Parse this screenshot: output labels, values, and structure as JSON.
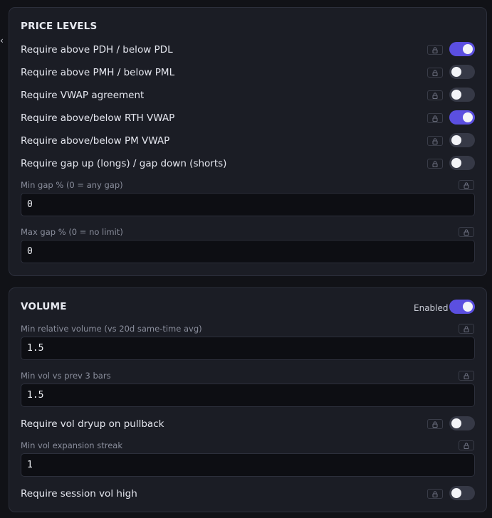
{
  "price_levels": {
    "title": "PRICE LEVELS",
    "toggles": [
      {
        "label": "Require above PDH / below PDL",
        "on": true
      },
      {
        "label": "Require above PMH / below PML",
        "on": false
      },
      {
        "label": "Require VWAP agreement",
        "on": false
      },
      {
        "label": "Require above/below RTH VWAP",
        "on": true
      },
      {
        "label": "Require above/below PM VWAP",
        "on": false
      },
      {
        "label": "Require gap up (longs) / gap down (shorts)",
        "on": false
      }
    ],
    "min_gap": {
      "label": "Min gap % (0 = any gap)",
      "value": "0"
    },
    "max_gap": {
      "label": "Max gap % (0 = no limit)",
      "value": "0"
    }
  },
  "volume": {
    "title": "VOLUME",
    "enabled_label": "Enabled",
    "enabled": true,
    "min_rel_vol": {
      "label": "Min relative volume (vs 20d same-time avg)",
      "value": "1.5"
    },
    "min_vol_prev": {
      "label": "Min vol vs prev 3 bars",
      "value": "1.5"
    },
    "vol_dryup": {
      "label": "Require vol dryup on pullback",
      "on": false
    },
    "min_vol_expansion": {
      "label": "Min vol expansion streak",
      "value": "1"
    },
    "session_vol_high": {
      "label": "Require session vol high",
      "on": false
    }
  },
  "colors": {
    "accent": "#5b4fe0",
    "card_bg": "#1b1d25",
    "page_bg": "#111217",
    "input_bg": "#0d0e13"
  },
  "icons": {
    "lock": "lock-icon",
    "side": "chevron-left-icon"
  }
}
